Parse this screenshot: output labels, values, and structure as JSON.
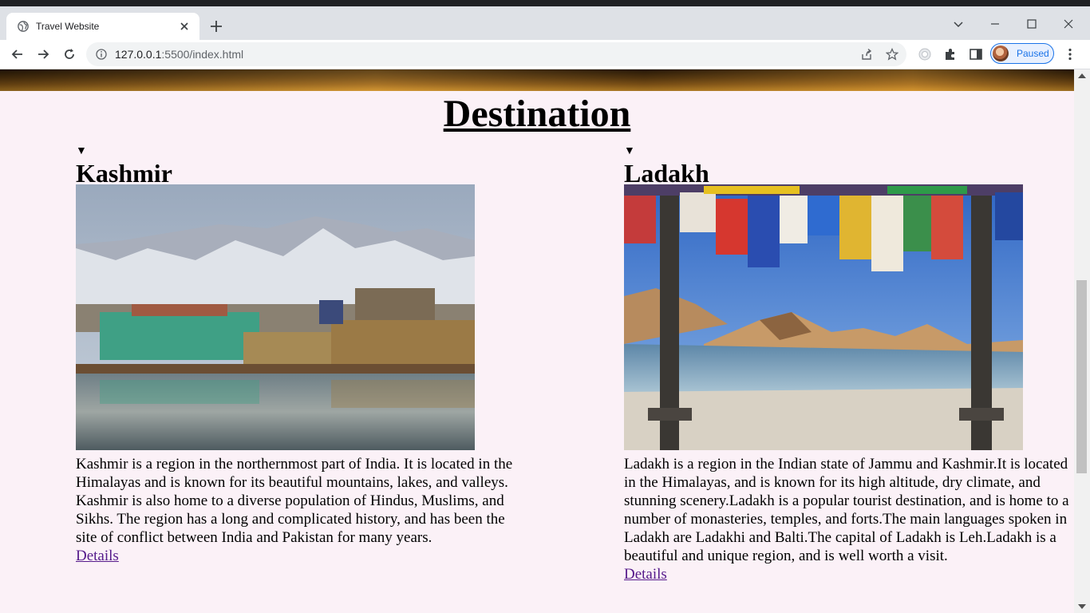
{
  "browser": {
    "tab_title": "Travel Website",
    "url_host": "127.0.0.1",
    "url_path": ":5500/index.html",
    "profile_label": "Paused",
    "icons": [
      "globe-icon",
      "close-icon",
      "plus-icon",
      "back-icon",
      "forward-icon",
      "reload-icon",
      "info-icon",
      "share-icon",
      "star-icon",
      "extension-icon",
      "puzzle-icon",
      "sidepanel-icon",
      "menu-icon"
    ],
    "accent": "#1a73e8"
  },
  "page": {
    "section_title": "Destination",
    "background": "#fbf1f7",
    "link_color": "#551a8b",
    "destinations": [
      {
        "marker": "▼",
        "name": "Kashmir",
        "image_alt": "Kashmir",
        "description": "Kashmir is a region in the northernmost part of India. It is located in the Himalayas and is known for its beautiful mountains, lakes, and valleys. Kashmir is also home to a diverse population of Hindus, Muslims, and Sikhs. The region has a long and complicated history, and has been the site of conflict between India and Pakistan for many years.",
        "link": "Details"
      },
      {
        "marker": "▼",
        "name": "Ladakh",
        "image_alt": "Ladakh",
        "description": "Ladakh is a region in the Indian state of Jammu and Kashmir.It is located in the Himalayas, and is known for its high altitude, dry climate, and stunning scenery.Ladakh is a popular tourist destination, and is home to a number of monasteries, temples, and forts.The main languages spoken in Ladakh are Ladakhi and Balti.The capital of Ladakh is Leh.Ladakh is a beautiful and unique region, and is well worth a visit.",
        "link": "Details"
      }
    ]
  }
}
